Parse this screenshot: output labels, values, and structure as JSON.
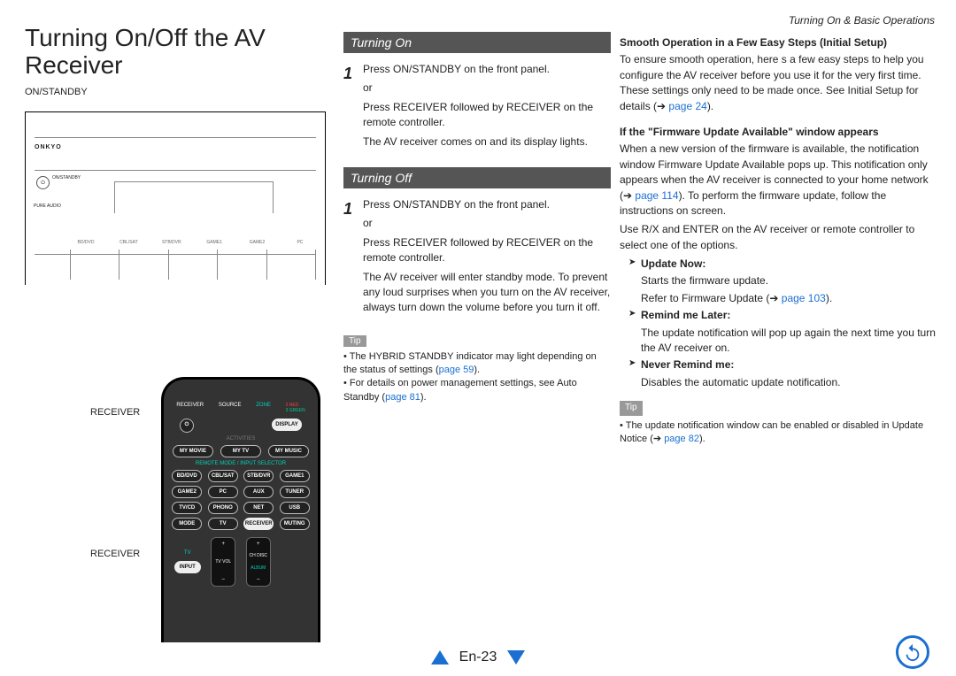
{
  "breadcrumb": "Turning On & Basic Operations",
  "title": "Turning On/Off the AV Receiver",
  "frontPanel": {
    "label": "ON/STANDBY",
    "brand": "ONKYO",
    "btnText": "ON/STANDBY",
    "pureAudio": "PURE AUDIO",
    "inputs": [
      "BD/DVD",
      "CBL/SAT",
      "STB/DVR",
      "GAME1",
      "GAME2",
      "PC"
    ]
  },
  "remote": {
    "label1": "RECEIVER",
    "label2": "RECEIVER",
    "topRow": {
      "receiver": "RECEIVER",
      "source": "SOURCE",
      "zone": "ZONE",
      "red": "2 RED",
      "green": "3 GREEN"
    },
    "row1": {
      "onstandby": "⏻",
      "display": "DISPLAY"
    },
    "row2_label": "ACTIVITIES",
    "row2": [
      "MY MOVIE",
      "MY TV",
      "MY MUSIC"
    ],
    "row3_label": "REMOTE MODE / INPUT SELECTOR",
    "row3": [
      "BD/DVD",
      "CBL/SAT",
      "STB/DVR",
      "GAME1"
    ],
    "row4": [
      "GAME2",
      "PC",
      "AUX",
      "TUNER"
    ],
    "row5": [
      "TV/CD",
      "PHONO",
      "NET",
      "USB"
    ],
    "row6": [
      "MODE",
      "TV",
      "RECEIVER",
      "MUTING"
    ],
    "bottom": {
      "tv": "TV",
      "input": "INPUT",
      "vol": "TV\nVOL",
      "ch": "CH\nDISC",
      "album": "ALBUM",
      "plus": "+",
      "minus": "–"
    }
  },
  "turningOn": {
    "heading": "Turning On",
    "step1a": "Press  ON/STANDBY on the front panel.",
    "or": "or",
    "step1b": "Press RECEIVER followed by   RECEIVER on the remote controller.",
    "step1c": "The AV receiver comes on and its display lights."
  },
  "turningOff": {
    "heading": "Turning Off",
    "step1a": "Press  ON/STANDBY on the front panel.",
    "or": "or",
    "step1b": "Press RECEIVER followed by   RECEIVER on the remote controller.",
    "step1c": "The AV receiver will enter standby mode. To prevent any loud surprises when you turn on the AV receiver, always turn down the volume before you turn it off."
  },
  "tip1": {
    "label": "Tip",
    "line1a": "The HYBRID STANDBY indicator may light depending on the status of settings (",
    "link1": "page 59",
    "line1b": ").",
    "line2a": "For details on power management settings, see  Auto Standby  (",
    "link2": "page 81",
    "line2b": ")."
  },
  "rightCol": {
    "smoothHeading": "Smooth Operation in a Few Easy Steps (Initial Setup)",
    "smoothBody1": "To ensure smooth operation, here s a few easy steps to help you configure the AV receiver before you use it for the very first time. These settings only need to be made once. See  Initial Setup  for details (",
    "smoothLink": "page 24",
    "smoothBody2": ").",
    "fwHeading": "If the \"Firmware Update Available\" window appears",
    "fwBody1": "When a new version of the firmware is available, the notification window  Firmware Update Available  pops up. This notification only appears when the AV receiver is connected to your home network (",
    "fwLink1": "page 114",
    "fwBody1b": "). To perform the firmware update, follow the instructions on screen.",
    "fwBody2": "Use R/X and ENTER on the AV receiver or remote controller to select one of the options.",
    "optUpdateLabel": "Update Now:",
    "optUpdateLine1": "Starts the firmware update.",
    "optUpdateLine2a": "Refer to  Firmware Update  (",
    "optUpdateLink": "page 103",
    "optUpdateLine2b": ").",
    "optRemindLabel": "Remind me Later:",
    "optRemindLine": "The update notification will pop up again the next time you turn the AV receiver on.",
    "optNeverLabel": "Never Remind me:",
    "optNeverLine": "Disables the automatic update notification.",
    "tip2Label": "Tip",
    "tip2Line1a": "The update notification window can be enabled or disabled in  Update Notice  (",
    "tip2Link": "page 82",
    "tip2Line1b": ")."
  },
  "footer": {
    "page": "En-23"
  }
}
